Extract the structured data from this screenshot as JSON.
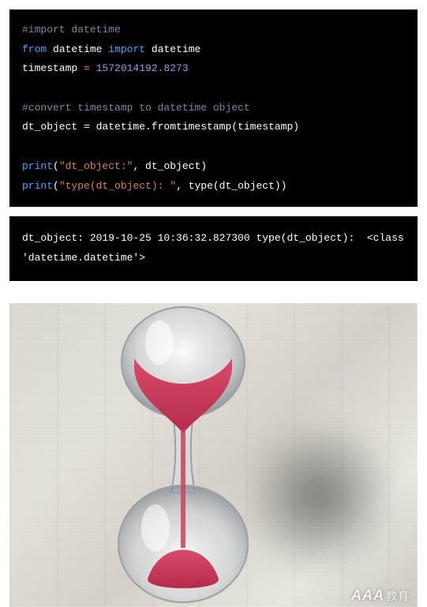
{
  "code": {
    "line1_comment": "#import datetime",
    "line2_from": "from",
    "line2_mod1": "datetime",
    "line2_import": "import",
    "line2_mod2": "datetime",
    "line3_var": "timestamp",
    "line3_eq": " = ",
    "line3_num": "1572014192.8273",
    "line4_comment": "#convert timestamp to datetime object",
    "line5": "dt_object = datetime.fromtimestamp(timestamp)",
    "line6_print": "print",
    "line6_paren_open": "(",
    "line6_str": "\"dt_object:\"",
    "line6_rest": ", dt_object)",
    "line7_print": "print",
    "line7_paren_open": "(",
    "line7_str": "\"type(dt_object): \"",
    "line7_rest": ", type(dt_object))"
  },
  "output": {
    "text": "dt_object: 2019-10-25 10:36:32.827300 type(dt_object):  <class 'datetime.datetime'>"
  },
  "image": {
    "description": "hourglass-with-red-sand-on-newspaper",
    "watermark_main": "AAA",
    "watermark_sub": "教育"
  }
}
